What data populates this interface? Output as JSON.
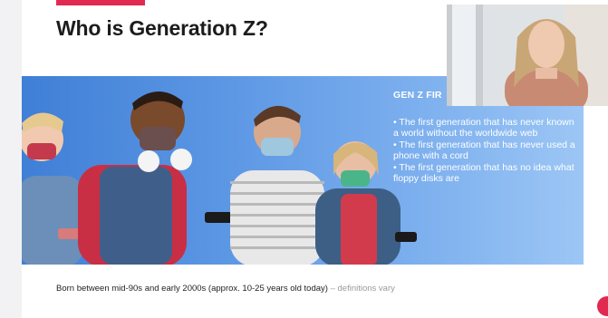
{
  "slide": {
    "title": "Who is Generation Z?",
    "info_heading": "GEN Z FIR",
    "bullets": [
      "• The first generation that has never known a world without the worldwide web",
      "• The first generation that has never used a phone with a cord",
      "• The first generation that has no idea what floppy disks are"
    ],
    "footer_main": "Born between mid-90s and early 2000s (approx. 10-25 years old today)",
    "footer_muted": " – definitions vary"
  },
  "colors": {
    "accent": "#e2294f",
    "photo_background": "#5b96e4",
    "title_text": "#1c1c1c"
  },
  "icons": {
    "corner_badge": "presentation-brand-badge"
  }
}
